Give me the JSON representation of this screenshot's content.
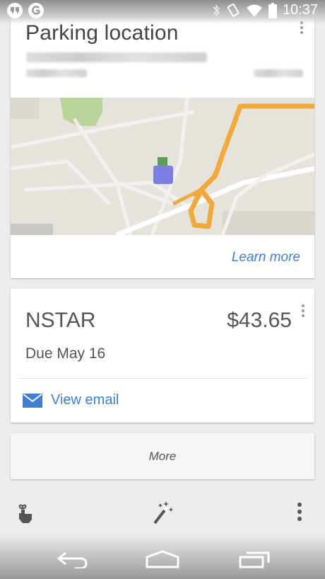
{
  "status_bar": {
    "time": "10:37",
    "left_icons": [
      "hangouts-icon",
      "google-now-icon"
    ],
    "right_icons": [
      "bluetooth-icon",
      "rotation-icon",
      "wifi-icon",
      "battery-icon"
    ]
  },
  "parking": {
    "title": "Parking location",
    "action_label": "Learn more"
  },
  "bill": {
    "name": "NSTAR",
    "amount": "$43.65",
    "due": "Due May 16",
    "email_label": "View email"
  },
  "more": {
    "label": "More"
  },
  "toolbar": {
    "icons": [
      "remind-finger-icon",
      "magic-wand-icon",
      "overflow-menu-icon"
    ]
  },
  "nav": {
    "icons": [
      "back-icon",
      "home-icon",
      "recents-icon"
    ]
  },
  "colors": {
    "link": "#3f7fd3",
    "route": "#f2a93b",
    "map_bg": "#e6e3dc",
    "park_pin": "#7b7fe0"
  }
}
